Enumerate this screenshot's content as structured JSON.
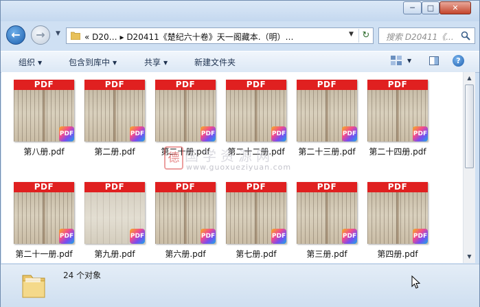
{
  "window": {
    "minimize_label": "─",
    "maximize_label": "□",
    "close_label": "✕"
  },
  "nav": {
    "back_icon": "←",
    "forward_icon": "→",
    "dropdown_icon": "▼",
    "address_path": "«  D20…  ▸  D20411《楚纪六十卷》天一阁藏本.（明）…",
    "address_dropdown": "▼",
    "refresh_icon": "↻",
    "search_placeholder": "搜索 D20411《..."
  },
  "toolbar": {
    "organize": "组织",
    "include_in_library": "包含到库中",
    "share": "共享",
    "new_folder": "新建文件夹",
    "dropdown_arrow": "▼",
    "help": "?"
  },
  "files": [
    {
      "name": "第八册.pdf",
      "banner": "PDF",
      "badge": "PDF"
    },
    {
      "name": "第二册.pdf",
      "banner": "PDF",
      "badge": "PDF"
    },
    {
      "name": "第二十册.pdf",
      "banner": "PDF",
      "badge": "PDF"
    },
    {
      "name": "第二十二册.pdf",
      "banner": "PDF",
      "badge": "PDF"
    },
    {
      "name": "第二十三册.pdf",
      "banner": "PDF",
      "badge": "PDF"
    },
    {
      "name": "第二十四册.pdf",
      "banner": "PDF",
      "badge": "PDF"
    },
    {
      "name": "第二十一册.pdf",
      "banner": "PDF",
      "badge": "PDF"
    },
    {
      "name": "第九册.pdf",
      "banner": "PDF",
      "badge": "PDF"
    },
    {
      "name": "第六册.pdf",
      "banner": "PDF",
      "badge": "PDF"
    },
    {
      "name": "第七册.pdf",
      "banner": "PDF",
      "badge": "PDF"
    },
    {
      "name": "第三册.pdf",
      "banner": "PDF",
      "badge": "PDF"
    },
    {
      "name": "第四册.pdf",
      "banner": "PDF",
      "badge": "PDF"
    }
  ],
  "watermark": {
    "logo": "德",
    "title": "国学资源网",
    "url": "www.guoxueziyuan.com"
  },
  "scrollbar": {
    "up_arrow": "▲",
    "down_arrow": "▼"
  },
  "status": {
    "item_count": "24 个对象"
  },
  "colors": {
    "pdf_banner": "#e02020",
    "window_frame": "#cfe0f3",
    "close_button": "#c4452c"
  }
}
